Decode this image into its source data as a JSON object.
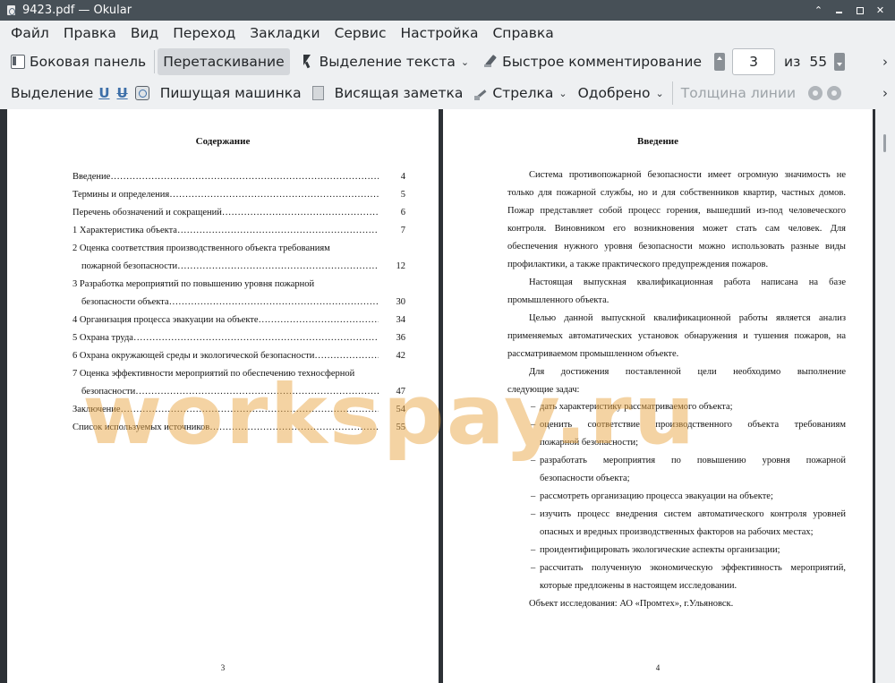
{
  "window": {
    "title": "9423.pdf  — Okular"
  },
  "menu": [
    "Файл",
    "Правка",
    "Вид",
    "Переход",
    "Закладки",
    "Сервис",
    "Настройка",
    "Справка"
  ],
  "toolbar1": {
    "sidebar": "Боковая панель",
    "browse": "Перетаскивание",
    "text_select": "Выделение текста",
    "quick_annot": "Быстрое комментирование",
    "page_current": "3",
    "page_of": "из",
    "page_total": "55"
  },
  "toolbar2": {
    "highlight": "Выделение",
    "typewriter": "Пишущая машинка",
    "popup_note": "Висящая заметка",
    "arrow": "Стрелка",
    "stamp": "Одобрено",
    "line_width": "Толщина линии"
  },
  "left_page": {
    "title": "Содержание",
    "toc": [
      {
        "text": "Введение",
        "page": "4"
      },
      {
        "text": "Термины и определения",
        "page": "5"
      },
      {
        "text": "Перечень обозначений и сокращений",
        "page": "6"
      },
      {
        "text": "1 Характеристика объекта",
        "page": "7"
      },
      {
        "text": "2 Оценка соответствия производственного объекта требованиям",
        "page": ""
      },
      {
        "text": "пожарной безопасности",
        "page": "12"
      },
      {
        "text": "3 Разработка мероприятий по повышению уровня пожарной",
        "page": ""
      },
      {
        "text": "безопасности объекта",
        "page": "30"
      },
      {
        "text": "4 Организация процесса эвакуации на объекте",
        "page": "34"
      },
      {
        "text": "5 Охрана труда",
        "page": "36"
      },
      {
        "text": "6 Охрана окружающей среды и экологической безопасности",
        "page": "42"
      },
      {
        "text": "7 Оценка эффективности мероприятий по обеспечению техносферной",
        "page": ""
      },
      {
        "text": "безопасности",
        "page": "47"
      },
      {
        "text": "Заключение",
        "page": "54"
      },
      {
        "text": "Список используемых источников",
        "page": "55"
      }
    ],
    "page_number": "3"
  },
  "right_page": {
    "title": "Введение",
    "lines": [
      "Система противопожарной безопасности имеет огромную значимость не",
      "только для пожарной службы, но и для собственников квартир, частных домов.",
      "Пожар представляет собой процесс горения, вышедший из-под человеческого",
      "контроля. Виновником его возникновения может стать сам человек. Для",
      "обеспечения нужного уровня безопасности можно использовать разные виды",
      "профилактики, а также практического предупреждения пожаров.",
      "Настоящая выпускная квалификационная работа написана на базе",
      "промышленного объекта.",
      "Целью данной выпускной квалификационной работы является анализ",
      "применяемых автоматических установок обнаружения и тушения пожаров, на",
      "рассматриваемом промышленном объекте.",
      "Для достижения поставленной цели необходимо выполнение",
      "следующие задач:"
    ],
    "list": [
      "дать характеристику рассматриваемого объекта;",
      "оценить соответствие производственного объекта требованиям",
      "пожарной безопасности;",
      "разработать мероприятия по повышению уровня пожарной",
      "безопасности объекта;",
      "рассмотреть организацию процесса эвакуации на объекте;",
      "изучить процесс внедрения систем автоматического контроля уровней",
      "опасных и вредных производственных факторов на рабочих местах;",
      "проидентифицировать экологические аспекты организации;",
      "рассчитать полученную экономическую эффективность мероприятий,",
      "которые предложены в настоящем исследовании."
    ],
    "object_line": "Объект исследования: АО «Промтех», г.Ульяновск.",
    "page_number": "4"
  },
  "watermark": "workspay.ru",
  "dots": "………………………………………………………………………………………………………………………………"
}
